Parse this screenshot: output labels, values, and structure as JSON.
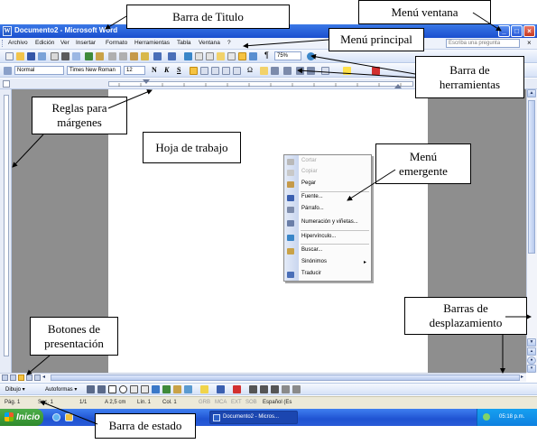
{
  "window": {
    "title": "Documento2 - Microsoft Word",
    "controls": {
      "minimize": "_",
      "maximize": "□",
      "close": "×"
    }
  },
  "menubar": {
    "items": [
      "Archivo",
      "Edición",
      "Ver",
      "Insertar",
      "Formato",
      "Herramientas",
      "Tabla",
      "Ventana",
      "?"
    ],
    "ask_placeholder": "Escriba una pregunta",
    "close_doc": "×"
  },
  "toolbar_standard": {
    "zoom": "75%",
    "pilcrow": "¶"
  },
  "toolbar_format": {
    "style": "Normal",
    "font": "Times New Roman",
    "size": "12",
    "bold": "N",
    "italic": "K",
    "underline": "S",
    "omega": "Ω"
  },
  "context_menu": {
    "items": [
      {
        "label": "Cortar",
        "disabled": true
      },
      {
        "label": "Copiar",
        "disabled": true
      },
      {
        "label": "Pegar",
        "disabled": false
      },
      {
        "label": "Fuente...",
        "disabled": false
      },
      {
        "label": "Párrafo...",
        "disabled": false
      },
      {
        "label": "Numeración y viñetas...",
        "disabled": false
      },
      {
        "label": "Hipervínculo...",
        "disabled": false
      },
      {
        "label": "Buscar...",
        "disabled": false
      },
      {
        "label": "Sinónimos",
        "disabled": false,
        "submenu": "▸"
      },
      {
        "label": "Traducir",
        "disabled": false
      }
    ]
  },
  "drawing_toolbar": {
    "draw": "Dibujo ▾",
    "autoshapes": "Autoformas ▾"
  },
  "statusbar": {
    "page": "Pág. 1",
    "section": "Sec. 1",
    "pages": "1/1",
    "at": "A 2,5 cm",
    "line": "Lín. 1",
    "col": "Col. 1",
    "grb": "GRB",
    "mca": "MCA",
    "ext": "EXT",
    "sob": "SOB",
    "lang": "Español (Es"
  },
  "taskbar": {
    "start": "Inicio",
    "task": "Documento2 - Micros...",
    "clock": "05:18 p.m."
  },
  "callouts": {
    "title_bar": "Barra de Titulo",
    "window_menu": "Menú ventana",
    "main_menu": "Menú principal",
    "toolbars_line1": "Barra de",
    "toolbars_line2": "herramientas",
    "margins_line1": "Reglas para",
    "margins_line2": "márgenes",
    "worksheet": "Hoja de trabajo",
    "popup_line1": "Menú",
    "popup_line2": "emergente",
    "scroll_line1": "Barras de",
    "scroll_line2": "desplazamiento",
    "view_line1": "Botones de",
    "view_line2": "presentación",
    "status": "Barra de estado"
  }
}
